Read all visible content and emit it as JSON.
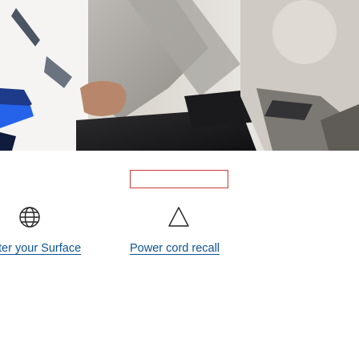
{
  "hero": {
    "image_icon": "photo-person-using-surface-laptop"
  },
  "tiles": [
    {
      "icon": "globe-icon",
      "link_label": "ter your Surface"
    },
    {
      "icon": "warning-triangle-icon",
      "link_label": "Power cord recall"
    }
  ],
  "colors": {
    "link": "#0b5394",
    "highlight_box": "#c9393b",
    "icon_stroke": "#222222"
  }
}
